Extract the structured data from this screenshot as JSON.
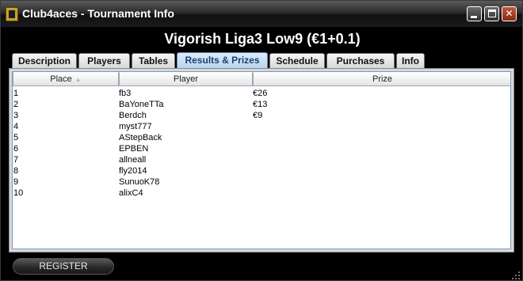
{
  "window": {
    "title": "Club4aces - Tournament Info",
    "buttons": {
      "minimize": "",
      "maximize": "",
      "close": "✕"
    }
  },
  "tournament": {
    "title": "Vigorish Liga3 Low9 (€1+0.1)"
  },
  "tabs": [
    {
      "label": "Description",
      "active": false
    },
    {
      "label": "Players",
      "active": false
    },
    {
      "label": "Tables",
      "active": false
    },
    {
      "label": "Results & Prizes",
      "active": true
    },
    {
      "label": "Schedule",
      "active": false
    },
    {
      "label": "Purchases",
      "active": false
    },
    {
      "label": "Info",
      "active": false
    }
  ],
  "results_table": {
    "columns": [
      "Place",
      "Player",
      "Prize"
    ],
    "sorted_by": "Place",
    "rows": [
      {
        "place": "1",
        "player": "fb3",
        "prize": "€26"
      },
      {
        "place": "2",
        "player": "BaYoneTTa",
        "prize": "€13"
      },
      {
        "place": "3",
        "player": "Berdch",
        "prize": "€9"
      },
      {
        "place": "4",
        "player": "myst777",
        "prize": ""
      },
      {
        "place": "5",
        "player": "AStepBack",
        "prize": ""
      },
      {
        "place": "6",
        "player": "EPBEN",
        "prize": ""
      },
      {
        "place": "7",
        "player": "allneall",
        "prize": ""
      },
      {
        "place": "8",
        "player": "fly2014",
        "prize": ""
      },
      {
        "place": "9",
        "player": "SunuoK78",
        "prize": ""
      },
      {
        "place": "10",
        "player": "alixC4",
        "prize": ""
      }
    ]
  },
  "register_button": {
    "label": "REGISTER"
  },
  "colors": {
    "accent": "#b9d3ee",
    "window_bg": "#000000"
  }
}
